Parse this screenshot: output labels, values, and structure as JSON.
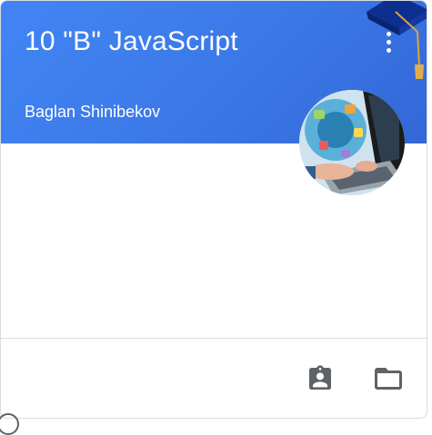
{
  "course": {
    "title": "10 \"B\" JavaScript",
    "teacher": "Baglan Shinibekov"
  },
  "colors": {
    "header": "#4285f4",
    "icon": "#5f6368",
    "divider": "#dadce0"
  },
  "icons": {
    "menu": "more-vert-icon",
    "decoration": "graduation-cap-icon",
    "avatar": "teacher-photo",
    "assignments": "assignment-ind-icon",
    "folder": "folder-icon"
  }
}
